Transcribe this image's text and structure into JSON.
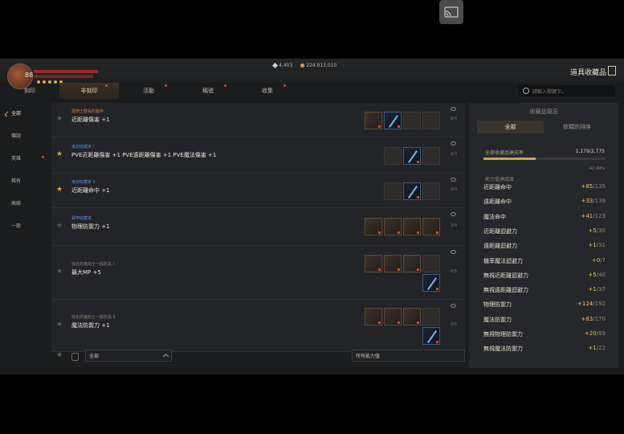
{
  "player": {
    "level": "88"
  },
  "currency": {
    "gems": "4,403",
    "gold": "224,913,010"
  },
  "header": {
    "title": "道具收藏品"
  },
  "tabs": [
    {
      "label": "刻印",
      "active": false,
      "dot": false
    },
    {
      "label": "非刻印",
      "active": true,
      "dot": true
    },
    {
      "label": "活動",
      "active": false,
      "dot": true
    },
    {
      "label": "稱號",
      "active": false,
      "dot": true
    },
    {
      "label": "收集",
      "active": false,
      "dot": true
    }
  ],
  "search": {
    "placeholder": "請輸入關鍵字。"
  },
  "sidebar": [
    {
      "label": "全部",
      "active": true,
      "dot": false
    },
    {
      "label": "傳說",
      "active": false,
      "dot": false
    },
    {
      "label": "英雄",
      "active": false,
      "dot": true
    },
    {
      "label": "稀有",
      "active": false,
      "dot": false
    },
    {
      "label": "高級",
      "active": false,
      "dot": false
    },
    {
      "label": "一般",
      "active": false,
      "dot": false
    }
  ],
  "rows": [
    {
      "category": "黑騎士團長的盔甲",
      "category_color": "#d9744a",
      "name": "近距離傷害 +1",
      "count": "0/4",
      "star_gold": false
    },
    {
      "category": "鬼劍收藏家 I",
      "category_color": "#5a8ad0",
      "name": "PVE近距離傷害 +1 PVE遠距離傷害 +1 PVE魔法傷害 +1",
      "count": "0/3",
      "star_gold": true
    },
    {
      "category": "鬼劍收藏家 II",
      "category_color": "#5a8ad0",
      "name": "近距離命中 +1",
      "count": "0/3",
      "star_gold": true
    },
    {
      "category": "寶甲收藏家",
      "category_color": "#5a8ad0",
      "name": "物理防禦力 +1",
      "count": "3/4",
      "star_gold": false
    },
    {
      "category": "強化的鬼劍士一般防具 I",
      "category_color": "#8a857c",
      "name": "最大MP +5",
      "count": "0/5",
      "star_gold": false
    },
    {
      "category": "強化的鬼劍士一般防具 II",
      "category_color": "#8a857c",
      "name": "魔法防禦力 +1",
      "count": "0/5",
      "star_gold": false
    }
  ],
  "filters": {
    "grade": "全部",
    "ability": "所有能力值"
  },
  "panel": {
    "title": "收藏品現況",
    "tabs": [
      {
        "label": "全部",
        "active": true
      },
      {
        "label": "依類別排序",
        "active": false
      }
    ],
    "progress_label": "全部收藏品達成率",
    "progress_value": "1,179/2,775",
    "progress_fraction": 0.4249,
    "progress_pct": "42.49%",
    "sub_label": "能力值達成度",
    "stats": [
      {
        "name": "近距離命中",
        "added": "+85",
        "max": "/135"
      },
      {
        "name": "遠距離命中",
        "added": "+33",
        "max": "/139"
      },
      {
        "name": "魔法命中",
        "added": "+41",
        "max": "/123"
      },
      {
        "name": "近距離迴避力",
        "added": "+5",
        "max": "/30"
      },
      {
        "name": "遠距離迴避力",
        "added": "+1",
        "max": "/31"
      },
      {
        "name": "機率魔法迴避力",
        "added": "+0",
        "max": "/7"
      },
      {
        "name": "無視近距離迴避力",
        "added": "+5",
        "max": "/40"
      },
      {
        "name": "無視遠距離迴避力",
        "added": "+1",
        "max": "/37"
      },
      {
        "name": "物理防禦力",
        "added": "+124",
        "max": "/192"
      },
      {
        "name": "魔法防禦力",
        "added": "+83",
        "max": "/170"
      },
      {
        "name": "無視物理防禦力",
        "added": "+20",
        "max": "/89"
      },
      {
        "name": "無視魔法防禦力",
        "added": "+1",
        "max": "/22"
      }
    ]
  },
  "colors": {
    "accent": "#d9a441",
    "bonus": "#e8c46a",
    "notify_dot": "#d04a2a"
  }
}
